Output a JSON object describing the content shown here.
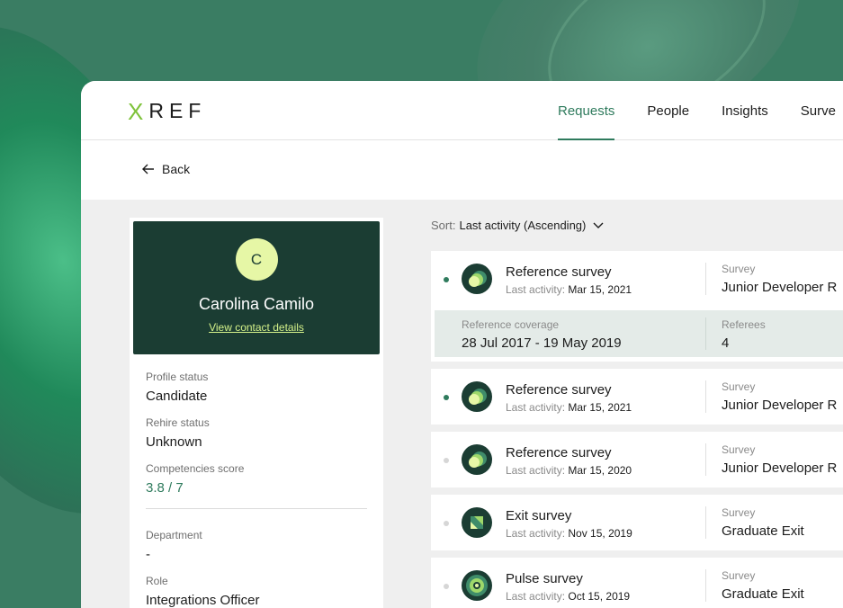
{
  "brand": {
    "logo_mark": "X",
    "logo_text": "REF",
    "accent": "#2f7b5d",
    "dark": "#1b3d33",
    "lime": "#d5f28a"
  },
  "nav": {
    "items": [
      {
        "label": "Requests",
        "active": true
      },
      {
        "label": "People"
      },
      {
        "label": "Insights"
      },
      {
        "label": "Surve"
      }
    ]
  },
  "back": {
    "label": "Back",
    "icon": "arrow-left-icon"
  },
  "profile": {
    "avatar_initial": "C",
    "name": "Carolina Camilo",
    "contact_link": "View contact details",
    "fields": [
      {
        "label": "Profile status",
        "value": "Candidate"
      },
      {
        "label": "Rehire status",
        "value": "Unknown"
      },
      {
        "label": "Competencies score",
        "value": "3.8 / 7"
      },
      {
        "label": "Department",
        "value": "-"
      },
      {
        "label": "Role",
        "value": "Integrations Officer"
      }
    ]
  },
  "sort": {
    "label": "Sort:",
    "value": "Last activity (Ascending)"
  },
  "list": {
    "activity_label": "Last activity:",
    "survey_label": "Survey",
    "items": [
      {
        "title": "Reference survey",
        "date": "Mar 15, 2021",
        "survey": "Junior Developer R",
        "unread": true,
        "icon": "reference-survey-icon",
        "expanded": {
          "coverage_label": "Reference coverage",
          "coverage": "28 Jul 2017 - 19 May 2019",
          "referees_label": "Referees",
          "referees": "4"
        }
      },
      {
        "title": "Reference survey",
        "date": "Mar 15, 2021",
        "survey": "Junior Developer R",
        "unread": true,
        "icon": "reference-survey-icon"
      },
      {
        "title": "Reference survey",
        "date": "Mar 15, 2020",
        "survey": "Junior Developer R",
        "unread": false,
        "icon": "reference-survey-icon"
      },
      {
        "title": "Exit survey",
        "date": "Nov 15, 2019",
        "survey": "Graduate Exit",
        "unread": false,
        "icon": "exit-survey-icon"
      },
      {
        "title": "Pulse survey",
        "date": "Oct 15, 2019",
        "survey": "Graduate Exit",
        "unread": false,
        "icon": "pulse-survey-icon"
      }
    ]
  }
}
